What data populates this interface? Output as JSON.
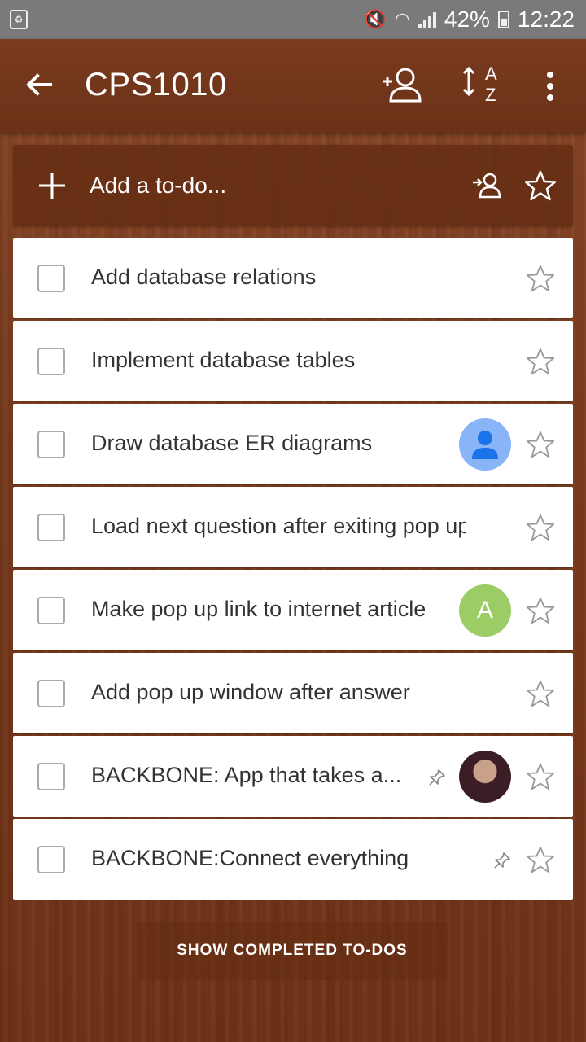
{
  "status_bar": {
    "battery": "42%",
    "time": "12:22"
  },
  "app_bar": {
    "title": "CPS1010"
  },
  "add_bar": {
    "placeholder": "Add a to-do..."
  },
  "todos": [
    {
      "title": "Add database relations",
      "avatar": null,
      "pinned": false
    },
    {
      "title": "Implement database tables",
      "avatar": null,
      "pinned": false
    },
    {
      "title": "Draw database ER diagrams",
      "avatar": "generic",
      "pinned": false
    },
    {
      "title": "Load next question after exiting pop up",
      "avatar": null,
      "pinned": false
    },
    {
      "title": "Make pop up link to internet article",
      "avatar": "letter",
      "avatar_letter": "A",
      "pinned": false
    },
    {
      "title": "Add pop up window after answer",
      "avatar": null,
      "pinned": false
    },
    {
      "title": "BACKBONE: App that takes a...",
      "avatar": "photo",
      "pinned": true
    },
    {
      "title": "BACKBONE:Connect everything",
      "avatar": null,
      "pinned": true
    }
  ],
  "footer": {
    "show_completed_label": "SHOW COMPLETED TO-DOS"
  },
  "colors": {
    "app_bar": "#6b3217",
    "status_bar": "#7a7a7a",
    "letter_avatar": "#9ccc65",
    "generic_avatar": "#8ab4f8"
  }
}
